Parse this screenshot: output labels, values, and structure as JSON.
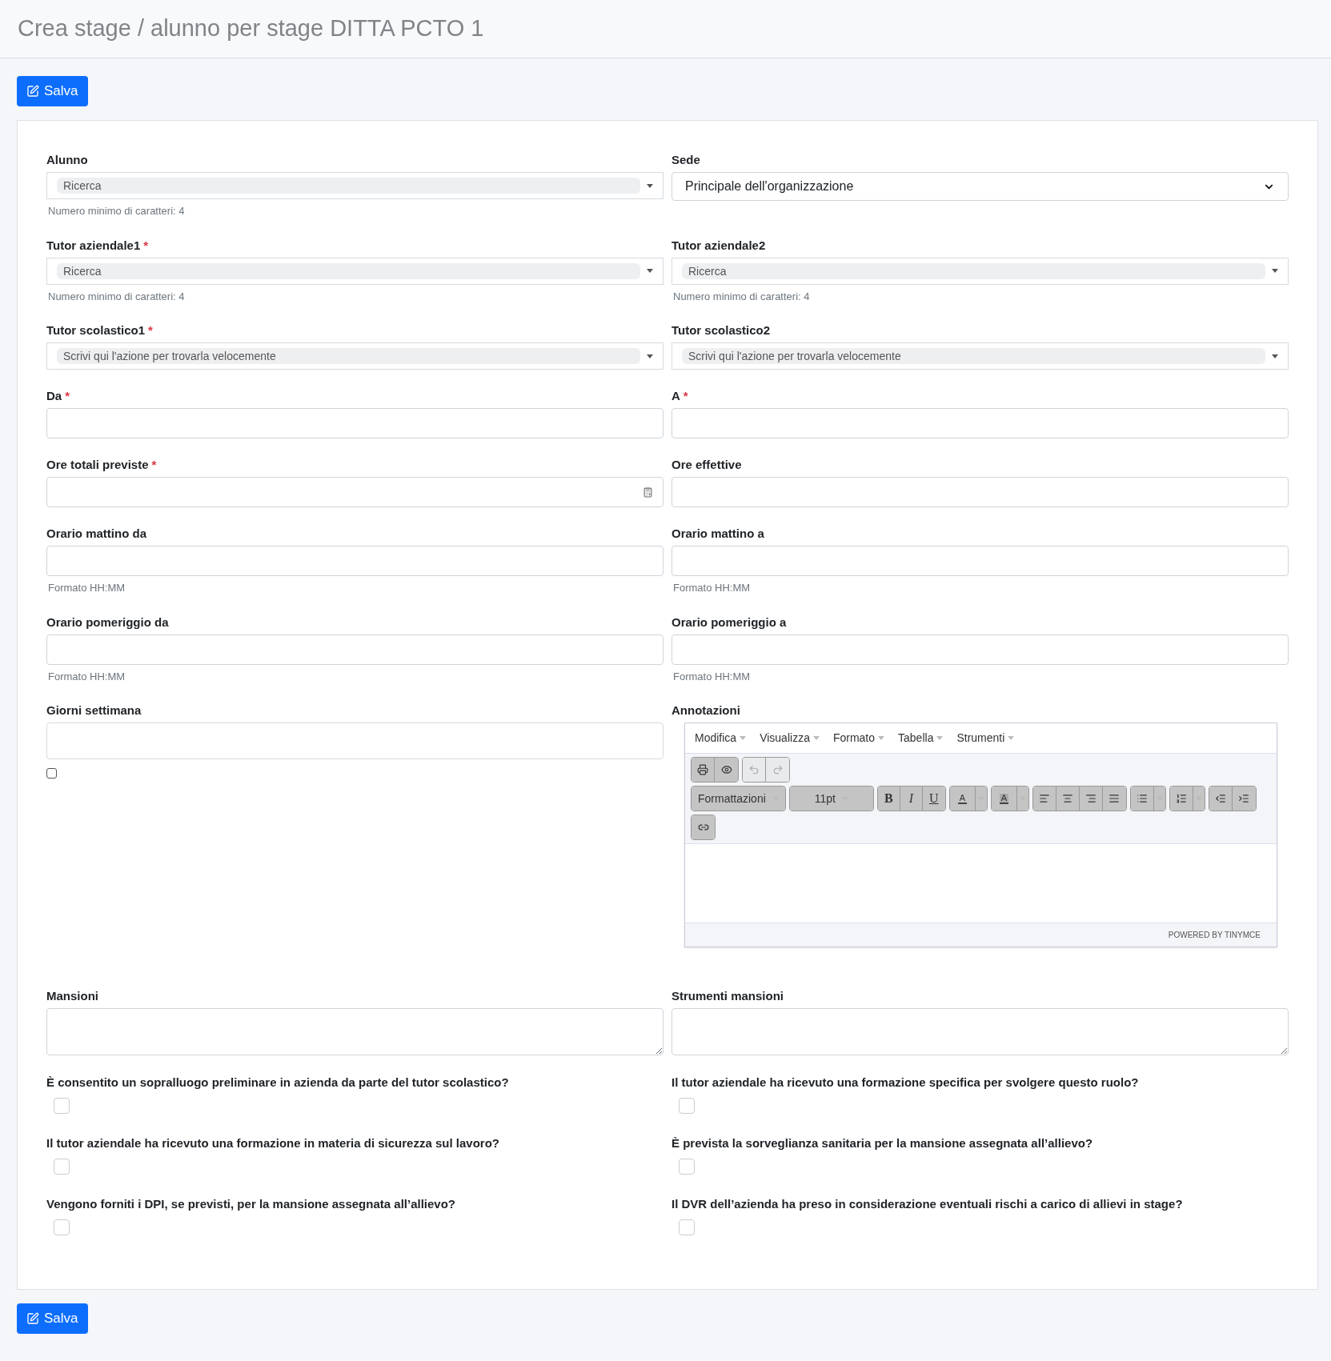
{
  "title": "Crea stage / alunno per stage DITTA PCTO 1",
  "top_button": "Salva",
  "rows": [
    [
      {
        "kind": "select2",
        "label": "Alunno",
        "value": "Ricerca",
        "help": "Numero minimo di caratteri: 4"
      },
      {
        "kind": "select",
        "label": "Sede",
        "value": "Principale dell'organizzazione"
      }
    ],
    [
      {
        "kind": "select2",
        "label": "Tutor aziendale1",
        "required_mark": "*",
        "value": "Ricerca",
        "help": "Numero minimo di caratteri: 4"
      },
      {
        "kind": "select2",
        "label": "Tutor aziendale2",
        "value": "Ricerca",
        "help": "Numero minimo di caratteri: 4"
      }
    ],
    [
      {
        "kind": "select2",
        "label": "Tutor scolastico1",
        "required_mark": "*",
        "value": "Scrivi qui l'azione per trovarla velocemente"
      },
      {
        "kind": "select2",
        "label": "Tutor scolastico2",
        "value": "Scrivi qui l'azione per trovarla velocemente"
      }
    ],
    [
      {
        "kind": "input",
        "label": "Da",
        "required_mark": "*"
      },
      {
        "kind": "input",
        "label": "A",
        "required_mark": "*"
      }
    ],
    [
      {
        "kind": "number",
        "label": "Ore totali previste",
        "required_mark": "*"
      },
      {
        "kind": "input",
        "label": "Ore effettive"
      }
    ],
    [
      {
        "kind": "input",
        "label": "Orario mattino da",
        "help": "Formato HH:MM"
      },
      {
        "kind": "input",
        "label": "Orario mattino a",
        "help": "Formato HH:MM"
      }
    ],
    [
      {
        "kind": "input",
        "label": "Orario pomeriggio da",
        "help": "Formato HH:MM"
      },
      {
        "kind": "input",
        "label": "Orario pomeriggio a",
        "help": "Formato HH:MM"
      }
    ],
    [
      {
        "kind": "tags",
        "label": "Giorni settimana",
        "checked": false
      },
      {
        "kind": "editor",
        "label": "Annotazioni",
        "menus": [
          "Modifica",
          "Visualizza",
          "Formato",
          "Tabella",
          "Strumenti"
        ],
        "toolbar_rows": [
          [
            [
              {
                "kind": "print",
                "disabled": false
              },
              {
                "kind": "preview",
                "disabled": false
              }
            ],
            [
              {
                "kind": "undo",
                "disabled": true
              },
              {
                "kind": "redo",
                "disabled": true
              }
            ]
          ],
          [
            [
              {
                "kind": "dropdown",
                "label": "Formattazioni",
                "disabled": false
              }
            ],
            [
              {
                "kind": "dropdown",
                "label": "11pt",
                "disabled": false
              }
            ],
            [
              {
                "kind": "bold",
                "label": "B",
                "disabled": false
              },
              {
                "kind": "italic",
                "label": "I",
                "disabled": false
              },
              {
                "kind": "underline",
                "label": "U",
                "disabled": false
              }
            ],
            [
              {
                "kind": "text-color",
                "label": "A",
                "disabled": false
              }
            ],
            [
              {
                "kind": "background-color",
                "label": "A",
                "disabled": false
              }
            ],
            [
              {
                "kind": "align-left",
                "disabled": false
              },
              {
                "kind": "align-center",
                "disabled": false
              },
              {
                "kind": "align-right",
                "disabled": false
              },
              {
                "kind": "justify",
                "disabled": false
              }
            ],
            [
              {
                "kind": "bullet-list",
                "disabled": false
              }
            ],
            [
              {
                "kind": "numbered-list",
                "disabled": false
              }
            ],
            [
              {
                "kind": "outdent",
                "disabled": false
              },
              {
                "kind": "indent",
                "disabled": false
              }
            ]
          ],
          [
            [
              {
                "kind": "link",
                "disabled": false
              }
            ]
          ]
        ],
        "footer": "POWERED BY TINYMCE"
      }
    ],
    [
      {
        "kind": "textarea",
        "label": "Mansioni"
      },
      {
        "kind": "textarea",
        "label": "Strumenti mansioni"
      }
    ],
    [
      {
        "kind": "question",
        "label": "È consentito un sopralluogo preliminare in azienda da parte del tutor scolastico?",
        "checked": false
      },
      {
        "kind": "question",
        "label": "Il tutor aziendale ha ricevuto una formazione specifica per svolgere questo ruolo?",
        "checked": false
      }
    ],
    [
      {
        "kind": "question",
        "label": "Il tutor aziendale ha ricevuto una formazione in materia di sicurezza sul lavoro?",
        "checked": false
      },
      {
        "kind": "question",
        "label": "È prevista la sorveglianza sanitaria per la mansione assegnata all’allievo?",
        "checked": false
      }
    ],
    [
      {
        "kind": "question",
        "label": "Vengono forniti i DPI, se previsti, per la mansione assegnata all’allievo?",
        "checked": false
      },
      {
        "kind": "question",
        "label": "Il DVR dell’azienda ha preso in considerazione eventuali rischi a carico di allievi in stage?",
        "checked": false
      }
    ]
  ],
  "bottom_button": "Salva"
}
